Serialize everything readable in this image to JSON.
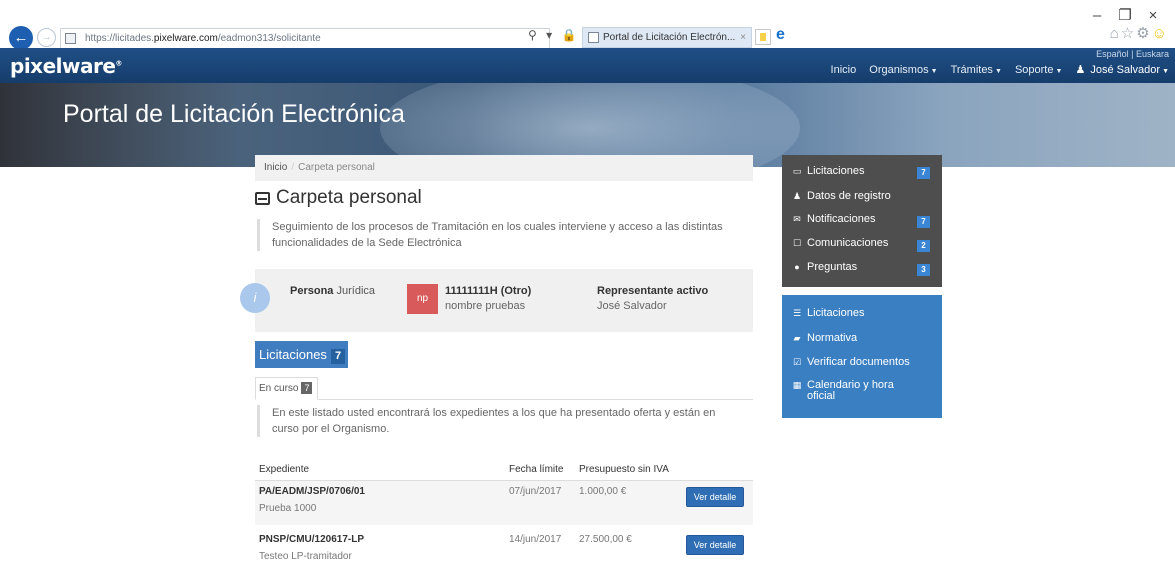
{
  "browser": {
    "url_prefix": "https://licitades.",
    "url_domain": "pixelware.com",
    "url_path": "/eadmon313/solicitante",
    "addr_icons": "⚲ ▾ 🔒 ↻",
    "tab_title": "Portal de Licitación Electrón...",
    "tab_close": "×",
    "win_minimize": "–",
    "win_restore": "❐",
    "win_close": "×",
    "back": "←",
    "forward": "→",
    "ie": "e"
  },
  "topbar": {
    "logo": "pixelware",
    "logo_mark": "®",
    "lang": "Español | Euskara",
    "nav": {
      "inicio": "Inicio",
      "organismos": "Organismos",
      "tramites": "Trámites",
      "soporte": "Soporte",
      "user": "José Salvador"
    }
  },
  "hero": {
    "title": "Portal de Licitación Electrónica"
  },
  "breadcrumb": {
    "home": "Inicio",
    "sep": "/",
    "current": "Carpeta personal"
  },
  "page": {
    "title": "Carpeta personal",
    "description": "Seguimiento de los procesos de Tramitación en los cuales interviene y acceso a las distintas funcionalidades de la Sede Electrónica"
  },
  "persona": {
    "info_icon": "i",
    "type_bold": "Persona",
    "type_rest": "Jurídica",
    "avatar": "np",
    "id": "11111111H (Otro)",
    "name": "nombre pruebas",
    "rep_label": "Representante activo",
    "rep_name": "José Salvador"
  },
  "licitaciones": {
    "label": "Licitaciones",
    "count": "7",
    "tab_label": "En curso",
    "tab_count": "7",
    "list_desc": "En este listado usted encontrará los expedientes a los que ha presentado oferta y están en curso por el Organismo."
  },
  "table": {
    "headers": {
      "expediente": "Expediente",
      "fecha": "Fecha límite",
      "presupuesto": "Presupuesto sin IVA"
    },
    "rows": [
      {
        "code": "PA/EADM/JSP/0706/01",
        "sub": "Prueba 1000",
        "date": "07/jun/2017",
        "amount": "1.000,00 €",
        "action": "Ver detalle"
      },
      {
        "code": "PNSP/CMU/120617-LP",
        "sub": "Testeo LP-tramitador",
        "date": "14/jun/2017",
        "amount": "27.500,00 €",
        "action": "Ver detalle"
      }
    ]
  },
  "sidebar_dark": {
    "items": [
      {
        "icon": "inbox-icon",
        "label": "Licitaciones",
        "count": "7"
      },
      {
        "icon": "user-icon",
        "label": "Datos de registro"
      },
      {
        "icon": "envelope-icon",
        "label": "Notificaciones",
        "count": "7"
      },
      {
        "icon": "envelope-outline-icon",
        "label": "Comunicaciones",
        "count": "2"
      },
      {
        "icon": "question-icon",
        "label": "Preguntas",
        "count": "3"
      }
    ]
  },
  "sidebar_blue": {
    "items": [
      {
        "icon": "list-icon",
        "label": "Licitaciones"
      },
      {
        "icon": "book-icon",
        "label": "Normativa"
      },
      {
        "icon": "check-square-icon",
        "label": "Verificar documentos"
      },
      {
        "icon": "calendar-icon",
        "label": "Calendario y hora",
        "label2": "oficial"
      }
    ]
  }
}
